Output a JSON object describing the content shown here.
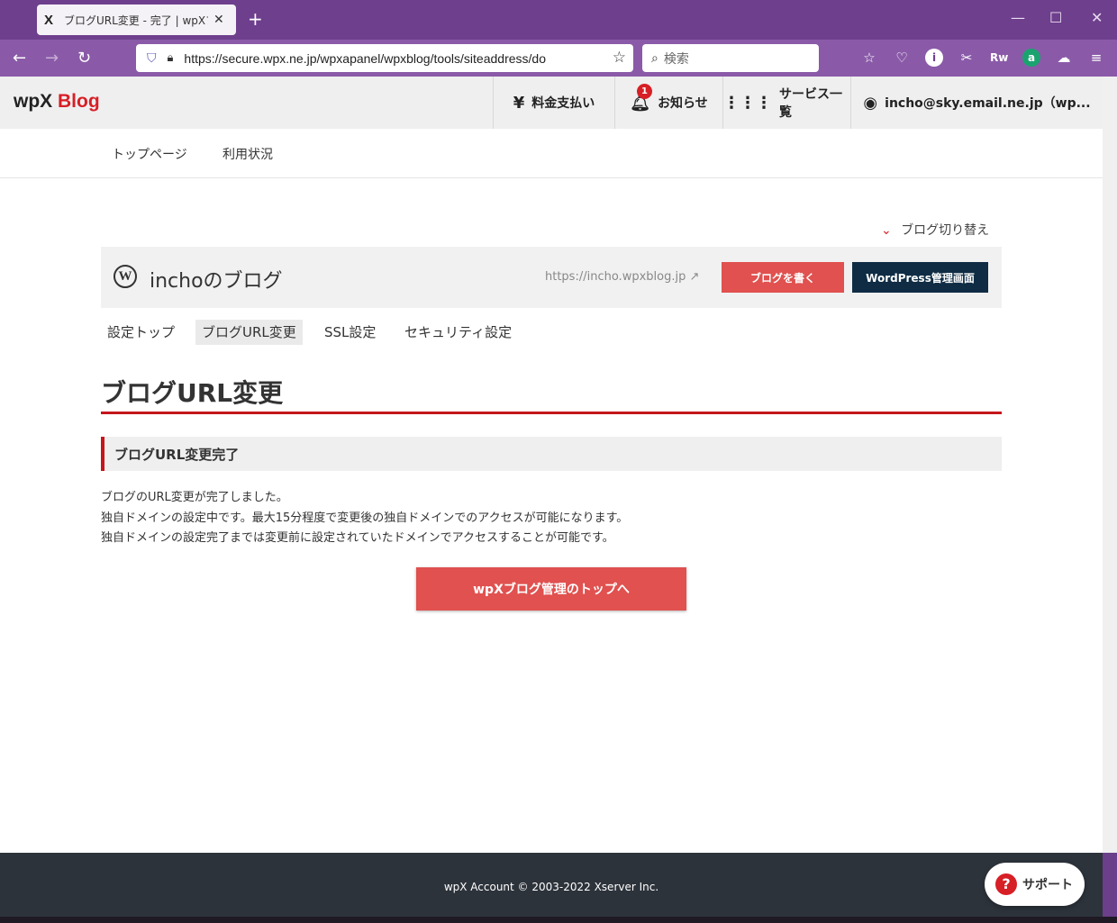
{
  "browser": {
    "tab_title": "ブログURL変更 - 完了 | wpXブログ",
    "tab_favicon": "X",
    "url": "https://secure.wpx.ne.jp/wpxapanel/wpxblog/tools/siteaddress/do",
    "search_placeholder": "検索"
  },
  "header": {
    "logo_wpx": "wpX",
    "logo_blog": "Blog",
    "payment": "料金支払い",
    "notifications": "お知らせ",
    "notification_count": "1",
    "services": "サービス一覧",
    "account": "incho@sky.email.ne.jp（wp..."
  },
  "subnav": {
    "items": [
      "トップページ",
      "利用状況"
    ]
  },
  "blog_switch": "ブログ切り替え",
  "blog_card": {
    "name": "inchoのブログ",
    "url": "https://incho.wpxblog.jp",
    "write_button": "ブログを書く",
    "wp_admin_button": "WordPress管理画面"
  },
  "settings_tabs": [
    {
      "label": "設定トップ",
      "active": false
    },
    {
      "label": "ブログURL変更",
      "active": true
    },
    {
      "label": "SSL設定",
      "active": false
    },
    {
      "label": "セキュリティ設定",
      "active": false
    }
  ],
  "page_title": "ブログURL変更",
  "section_title": "ブログURL変更完了",
  "messages": [
    "ブログのURL変更が完了しました。",
    "独自ドメインの設定中です。最大15分程度で変更後の独自ドメインでのアクセスが可能になります。",
    "独自ドメインの設定完了までは変更前に設定されていたドメインでアクセスすることが可能です。"
  ],
  "top_button": "wpXブログ管理のトップへ",
  "footer": "wpX Account © 2003-2022 Xserver Inc.",
  "support": "サポート",
  "colors": {
    "accent_red": "#d71f26",
    "button_red": "#e0514f",
    "navy": "#0f2c44",
    "browser_purple": "#6e3f8d"
  }
}
